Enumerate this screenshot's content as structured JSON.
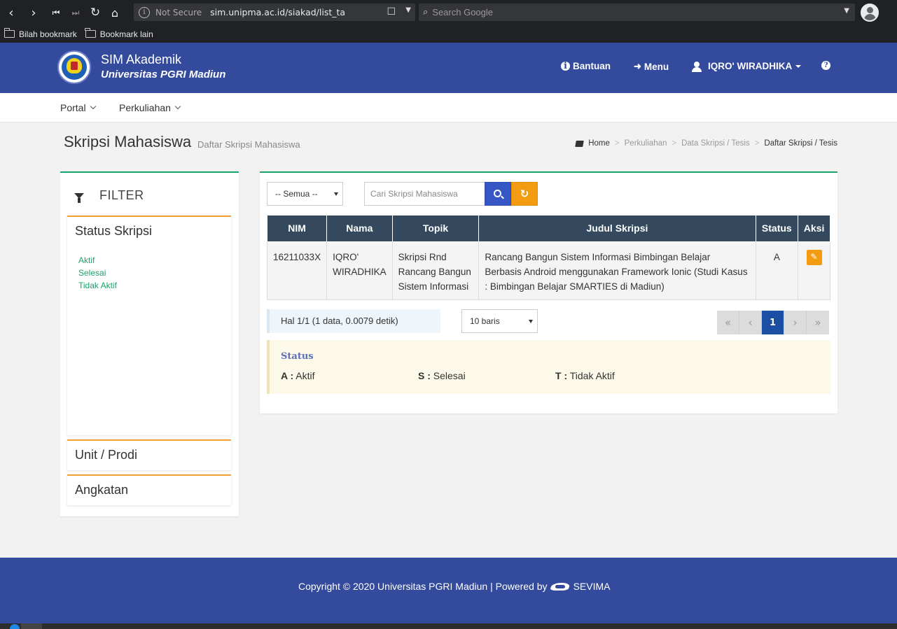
{
  "browser": {
    "not_secure": "Not Secure",
    "url": "sim.unipma.ac.id/siakad/list_ta",
    "search_placeholder": "Search Google",
    "bookmarks": [
      "Bilah bookmark",
      "Bookmark lain"
    ]
  },
  "header": {
    "app_name": "SIM Akademik",
    "university": "Universitas PGRI Madiun",
    "help_label": "Bantuan",
    "menu_label": "Menu",
    "user_name": "IQRO' WIRADHIKA"
  },
  "menubar": {
    "items": [
      "Portal",
      "Perkuliahan"
    ]
  },
  "page": {
    "title": "Skripsi Mahasiswa",
    "subtitle": "Daftar Skripsi Mahasiswa",
    "breadcrumb": [
      "Home",
      "Perkuliahan",
      "Data Skripsi / Tesis",
      "Daftar Skripsi / Tesis"
    ]
  },
  "filter": {
    "heading": "FILTER",
    "status_title": "Status Skripsi",
    "status_options": [
      "Aktif",
      "Selesai",
      "Tidak Aktif"
    ],
    "unit_title": "Unit / Prodi",
    "angkatan_title": "Angkatan"
  },
  "toolbar": {
    "select_value": "-- Semua --",
    "search_placeholder": "Cari Skripsi Mahasiswa"
  },
  "table": {
    "headers": [
      "NIM",
      "Nama",
      "Topik",
      "Judul Skripsi",
      "Status",
      "Aksi"
    ],
    "rows": [
      {
        "nim": "16211033X",
        "nama": "IQRO' WIRADHIKA",
        "topik": "Skripsi Rnd Rancang Bangun Sistem Informasi",
        "judul": "Rancang Bangun Sistem Informasi Bimbingan Belajar Berbasis Android menggunakan Framework Ionic (Studi Kasus : Bimbingan Belajar SMARTIES di Madiun)",
        "status": "A"
      }
    ]
  },
  "pagination": {
    "info": "Hal 1/1 (1 data, 0.0079 detik)",
    "rows_value": "10 baris",
    "first": "«",
    "prev": "‹",
    "current": "1",
    "next": "›",
    "last": "»"
  },
  "legend": {
    "title": "Status",
    "items": [
      {
        "code": "A :",
        "label": " Aktif"
      },
      {
        "code": "S :",
        "label": " Selesai"
      },
      {
        "code": "T :",
        "label": " Tidak Aktif"
      }
    ]
  },
  "footer": {
    "copyright": "Copyright © 2020 Universitas PGRI Madiun | Powered by",
    "brand": "SEVIMA"
  }
}
